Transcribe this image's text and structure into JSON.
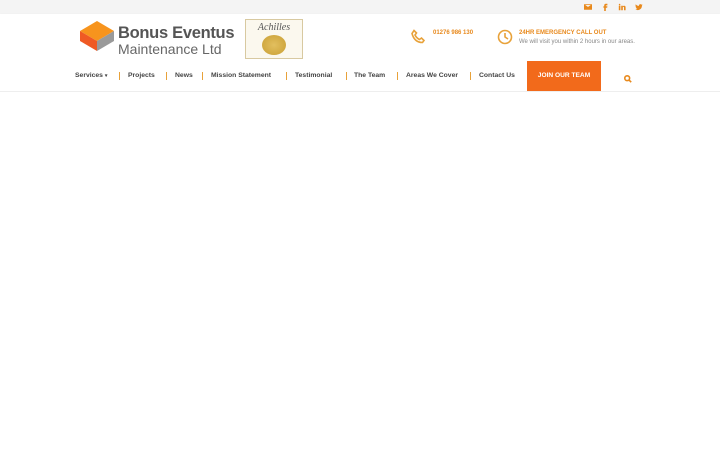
{
  "brand": {
    "line1": "Bonus Eventus",
    "line2": "Maintenance Ltd"
  },
  "badge": {
    "title": "Achilles"
  },
  "social": [
    "mail-icon",
    "facebook-icon",
    "linkedin-icon",
    "twitter-icon"
  ],
  "contact": {
    "phone": "01276 986 130",
    "emergency_title": "24HR EMERGENCY CALL OUT",
    "emergency_text": "We will visit you within 2 hours in our areas."
  },
  "nav": {
    "items": [
      "Services",
      "Projects",
      "News",
      "Mission Statement",
      "Testimonial",
      "The Team",
      "Areas We Cover",
      "Contact Us"
    ],
    "cta": "JOIN OUR TEAM"
  },
  "colors": {
    "accent": "#e8891c",
    "cta": "#f26a1b"
  }
}
